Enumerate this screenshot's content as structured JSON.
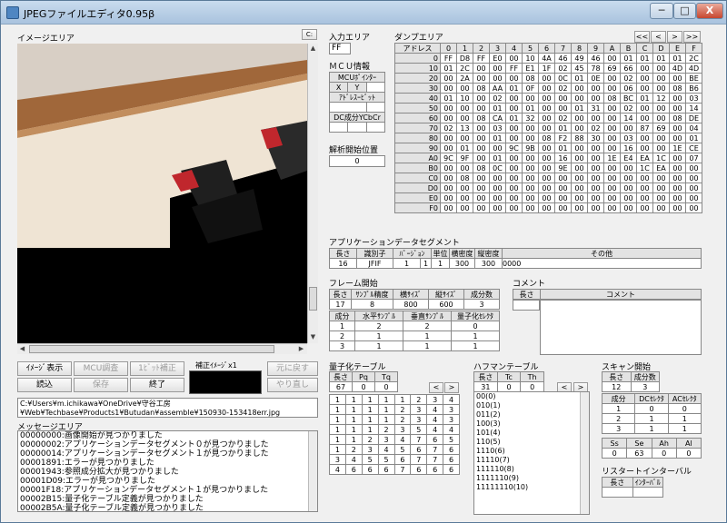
{
  "window": {
    "title": "JPEGファイルエディタ0.95β",
    "minimize": "─",
    "maximize": "□",
    "close": "X"
  },
  "image_area": {
    "label": "イメージエリア",
    "corner_button": "C:"
  },
  "buttons": {
    "image_display": "ｲﾒｰｼﾞ表示",
    "mcu_adjust": "MCU調査",
    "bit_adjust": "1ﾋﾞｯﾄ補正",
    "corrected_image": "補正ｲﾒｰｼﾞx1",
    "revert": "元に戻す",
    "load": "読込",
    "save": "保存",
    "exit": "終了",
    "redo": "やり直し"
  },
  "file_path": [
    "C:¥Users¥m.ichikawa¥OneDrive¥守谷工房",
    "¥Web¥Techbase¥Products1¥Butudan¥assemble¥150930-153418err.jpg"
  ],
  "message_area": {
    "label": "メッセージエリア",
    "lines": [
      "00000000:画像開始が見つかりました",
      "00000002:アプリケーションデータセグメント０が見つかりました",
      "00000014:アプリケーションデータセグメント１が見つかりました",
      "00001891:エラーが見つかりました",
      "00001943:参照成分拡大が見つかりました",
      "00001D09:エラーが見つかりました",
      "00001F18:アプリケーションデータセグメント１が見つかりました",
      "00002B15:量子化テーブル定義が見つかりました",
      "00002B5A:量子化テーブル定義が見つかりました"
    ]
  },
  "input_area": {
    "label": "入力エリア",
    "value": "FF"
  },
  "mcu_info": {
    "label": "ＭＣＵ情報",
    "pointer_label": "MCUﾎﾟｲﾝﾀｰ",
    "x_label": "X",
    "y_label": "Y",
    "address_bit_label": "ｱﾄﾞﾚｽｰﾋﾞｯﾄ",
    "dc_component_label": "DC成分YCbCr",
    "analysis_label": "解析開始位置",
    "analysis_value": "0"
  },
  "dump_area": {
    "label": "ダンプエリア",
    "nav": [
      "<<",
      "<",
      ">",
      ">>"
    ],
    "address_header": "アドレス",
    "columns": [
      "0",
      "1",
      "2",
      "3",
      "4",
      "5",
      "6",
      "7",
      "8",
      "9",
      "A",
      "B",
      "C",
      "D",
      "E",
      "F"
    ],
    "rows": [
      {
        "addr": "0",
        "bytes": [
          "FF",
          "D8",
          "FF",
          "E0",
          "00",
          "10",
          "4A",
          "46",
          "49",
          "46",
          "00",
          "01",
          "01",
          "01",
          "01",
          "2C"
        ]
      },
      {
        "addr": "10",
        "bytes": [
          "01",
          "2C",
          "00",
          "00",
          "FF",
          "E1",
          "1F",
          "02",
          "45",
          "78",
          "69",
          "66",
          "00",
          "00",
          "4D",
          "4D"
        ]
      },
      {
        "addr": "20",
        "bytes": [
          "00",
          "2A",
          "00",
          "00",
          "00",
          "08",
          "00",
          "0C",
          "01",
          "0E",
          "00",
          "02",
          "00",
          "00",
          "00",
          "BE"
        ]
      },
      {
        "addr": "30",
        "bytes": [
          "00",
          "00",
          "08",
          "AA",
          "01",
          "0F",
          "00",
          "02",
          "00",
          "00",
          "00",
          "06",
          "00",
          "00",
          "08",
          "B6"
        ]
      },
      {
        "addr": "40",
        "bytes": [
          "01",
          "10",
          "00",
          "02",
          "00",
          "00",
          "00",
          "00",
          "00",
          "00",
          "08",
          "BC",
          "01",
          "12",
          "00",
          "03"
        ]
      },
      {
        "addr": "50",
        "bytes": [
          "00",
          "00",
          "00",
          "01",
          "00",
          "01",
          "00",
          "00",
          "01",
          "31",
          "00",
          "02",
          "00",
          "00",
          "00",
          "14"
        ]
      },
      {
        "addr": "60",
        "bytes": [
          "00",
          "00",
          "08",
          "CA",
          "01",
          "32",
          "00",
          "02",
          "00",
          "00",
          "00",
          "14",
          "00",
          "00",
          "08",
          "DE"
        ]
      },
      {
        "addr": "70",
        "bytes": [
          "02",
          "13",
          "00",
          "03",
          "00",
          "00",
          "00",
          "01",
          "00",
          "02",
          "00",
          "00",
          "87",
          "69",
          "00",
          "04"
        ]
      },
      {
        "addr": "80",
        "bytes": [
          "00",
          "00",
          "00",
          "01",
          "00",
          "00",
          "08",
          "F2",
          "88",
          "30",
          "00",
          "03",
          "00",
          "00",
          "00",
          "01"
        ]
      },
      {
        "addr": "90",
        "bytes": [
          "00",
          "01",
          "00",
          "00",
          "9C",
          "9B",
          "00",
          "01",
          "00",
          "00",
          "00",
          "16",
          "00",
          "00",
          "1E",
          "CE"
        ]
      },
      {
        "addr": "A0",
        "bytes": [
          "9C",
          "9F",
          "00",
          "01",
          "00",
          "00",
          "00",
          "16",
          "00",
          "00",
          "1E",
          "E4",
          "EA",
          "1C",
          "00",
          "07"
        ]
      },
      {
        "addr": "B0",
        "bytes": [
          "00",
          "00",
          "08",
          "0C",
          "00",
          "00",
          "00",
          "9E",
          "00",
          "00",
          "00",
          "00",
          "1C",
          "EA",
          "00",
          "00"
        ]
      },
      {
        "addr": "C0",
        "bytes": [
          "00",
          "08",
          "00",
          "00",
          "00",
          "00",
          "00",
          "00",
          "00",
          "00",
          "00",
          "00",
          "00",
          "00",
          "00",
          "00"
        ]
      },
      {
        "addr": "D0",
        "bytes": [
          "00",
          "00",
          "00",
          "00",
          "00",
          "00",
          "00",
          "00",
          "00",
          "00",
          "00",
          "00",
          "00",
          "00",
          "00",
          "00"
        ]
      },
      {
        "addr": "E0",
        "bytes": [
          "00",
          "00",
          "00",
          "00",
          "00",
          "00",
          "00",
          "00",
          "00",
          "00",
          "00",
          "00",
          "00",
          "00",
          "00",
          "00"
        ]
      },
      {
        "addr": "F0",
        "bytes": [
          "00",
          "00",
          "00",
          "00",
          "00",
          "00",
          "00",
          "00",
          "00",
          "00",
          "00",
          "00",
          "00",
          "00",
          "00",
          "00"
        ]
      }
    ]
  },
  "app_segment": {
    "label": "アプリケーションデータセグメント",
    "headers": [
      "長さ",
      "識別子",
      "ﾊﾞｰｼﾞｮﾝ",
      "単位",
      "横密度",
      "縦密度",
      "その他"
    ],
    "values": [
      "16",
      "JFIF",
      "1",
      "1",
      "1",
      "300",
      "300",
      "0000"
    ]
  },
  "frame_start": {
    "label": "フレーム開始",
    "headers1": [
      "長さ",
      "ｻﾝﾌﾟﾙ精度",
      "横ｻｲｽﾞ",
      "縦ｻｲｽﾞ",
      "成分数"
    ],
    "values1": [
      "17",
      "8",
      "800",
      "600",
      "3"
    ],
    "headers2": [
      "成分",
      "水平ｻﾝﾌﾟﾙ",
      "垂直ｻﾝﾌﾟﾙ",
      "量子化ｾﾚｸﾀ"
    ],
    "rows2": [
      [
        "1",
        "2",
        "2",
        "0"
      ],
      [
        "2",
        "1",
        "1",
        "1"
      ],
      [
        "3",
        "1",
        "1",
        "1"
      ]
    ]
  },
  "comment": {
    "label": "コメント",
    "length_header": "長さ",
    "comment_header": "コメント"
  },
  "quant_table": {
    "label": "量子化テーブル",
    "headers": [
      "長さ",
      "Pq",
      "Tq"
    ],
    "values": [
      "67",
      "0",
      "0"
    ],
    "nav": [
      "<",
      ">"
    ],
    "matrix": [
      [
        "1",
        "1",
        "1",
        "1",
        "1",
        "2",
        "3",
        "4"
      ],
      [
        "1",
        "1",
        "1",
        "1",
        "2",
        "3",
        "4",
        "3"
      ],
      [
        "1",
        "1",
        "1",
        "1",
        "2",
        "3",
        "4",
        "3"
      ],
      [
        "1",
        "1",
        "1",
        "2",
        "3",
        "5",
        "4",
        "4"
      ],
      [
        "1",
        "1",
        "2",
        "3",
        "4",
        "7",
        "6",
        "5"
      ],
      [
        "1",
        "2",
        "3",
        "4",
        "5",
        "6",
        "7",
        "6"
      ],
      [
        "3",
        "4",
        "5",
        "5",
        "6",
        "7",
        "7",
        "6"
      ],
      [
        "4",
        "6",
        "6",
        "6",
        "7",
        "6",
        "6",
        "6"
      ]
    ]
  },
  "huffman": {
    "label": "ハフマンテーブル",
    "headers": [
      "長さ",
      "Tc",
      "Th"
    ],
    "values": [
      "31",
      "0",
      "0"
    ],
    "nav": [
      "<",
      ">"
    ],
    "codes": [
      "00(0)",
      "010(1)",
      "011(2)",
      "100(3)",
      "101(4)",
      "110(5)",
      "1110(6)",
      "11110(7)",
      "111110(8)",
      "1111110(9)",
      "11111110(10)"
    ]
  },
  "scan_start": {
    "label": "スキャン開始",
    "headers1": [
      "長さ",
      "成分数"
    ],
    "values1": [
      "12",
      "3"
    ],
    "headers2": [
      "成分",
      "DCｾﾚｸﾀ",
      "ACｾﾚｸﾀ"
    ],
    "rows2": [
      [
        "1",
        "0",
        "0"
      ],
      [
        "2",
        "1",
        "1"
      ],
      [
        "3",
        "1",
        "1"
      ]
    ],
    "headers3": [
      "Ss",
      "Se",
      "Ah",
      "Al"
    ],
    "values3": [
      "0",
      "63",
      "0",
      "0"
    ]
  },
  "restart": {
    "label": "リスタートインターバル",
    "headers": [
      "長さ",
      "ｲﾝﾀｰﾊﾞﾙ"
    ]
  }
}
